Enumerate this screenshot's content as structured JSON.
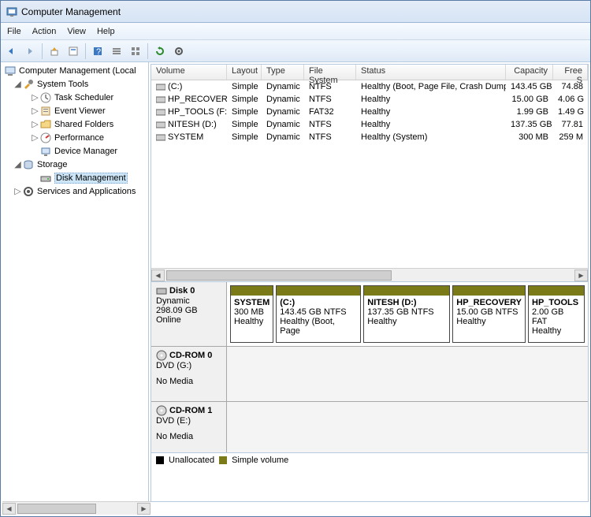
{
  "window": {
    "title": "Computer Management"
  },
  "menu": {
    "file": "File",
    "action": "Action",
    "view": "View",
    "help": "Help"
  },
  "tree": {
    "root": "Computer Management (Local",
    "system_tools": "System Tools",
    "task_scheduler": "Task Scheduler",
    "event_viewer": "Event Viewer",
    "shared_folders": "Shared Folders",
    "performance": "Performance",
    "device_manager": "Device Manager",
    "storage": "Storage",
    "disk_management": "Disk Management",
    "services": "Services and Applications"
  },
  "cols": {
    "volume": "Volume",
    "layout": "Layout",
    "type": "Type",
    "fs": "File System",
    "status": "Status",
    "capacity": "Capacity",
    "free": "Free S"
  },
  "volumes": [
    {
      "name": "(C:)",
      "layout": "Simple",
      "type": "Dynamic",
      "fs": "NTFS",
      "status": "Healthy (Boot, Page File, Crash Dump)",
      "cap": "143.45 GB",
      "free": "74.88"
    },
    {
      "name": "HP_RECOVERY",
      "layout": "Simple",
      "type": "Dynamic",
      "fs": "NTFS",
      "status": "Healthy",
      "cap": "15.00 GB",
      "free": "4.06 G"
    },
    {
      "name": "HP_TOOLS (F:)",
      "layout": "Simple",
      "type": "Dynamic",
      "fs": "FAT32",
      "status": "Healthy",
      "cap": "1.99 GB",
      "free": "1.49 G"
    },
    {
      "name": "NITESH (D:)",
      "layout": "Simple",
      "type": "Dynamic",
      "fs": "NTFS",
      "status": "Healthy",
      "cap": "137.35 GB",
      "free": "77.81"
    },
    {
      "name": "SYSTEM",
      "layout": "Simple",
      "type": "Dynamic",
      "fs": "NTFS",
      "status": "Healthy (System)",
      "cap": "300 MB",
      "free": "259 M"
    }
  ],
  "disk0": {
    "title": "Disk 0",
    "type": "Dynamic",
    "size": "298.09 GB",
    "status": "Online",
    "parts": [
      {
        "name": "SYSTEM",
        "line2": "300 MB",
        "line3": "Healthy"
      },
      {
        "name": "(C:)",
        "line2": "143.45 GB NTFS",
        "line3": "Healthy (Boot, Page"
      },
      {
        "name": "NITESH  (D:)",
        "line2": "137.35 GB NTFS",
        "line3": "Healthy"
      },
      {
        "name": "HP_RECOVERY",
        "line2": "15.00 GB NTFS",
        "line3": "Healthy"
      },
      {
        "name": "HP_TOOLS",
        "line2": "2.00 GB FAT",
        "line3": "Healthy"
      }
    ]
  },
  "cd0": {
    "title": "CD-ROM 0",
    "dev": "DVD (G:)",
    "status": "No Media"
  },
  "cd1": {
    "title": "CD-ROM 1",
    "dev": "DVD (E:)",
    "status": "No Media"
  },
  "legend": {
    "unalloc": "Unallocated",
    "simple": "Simple volume"
  }
}
